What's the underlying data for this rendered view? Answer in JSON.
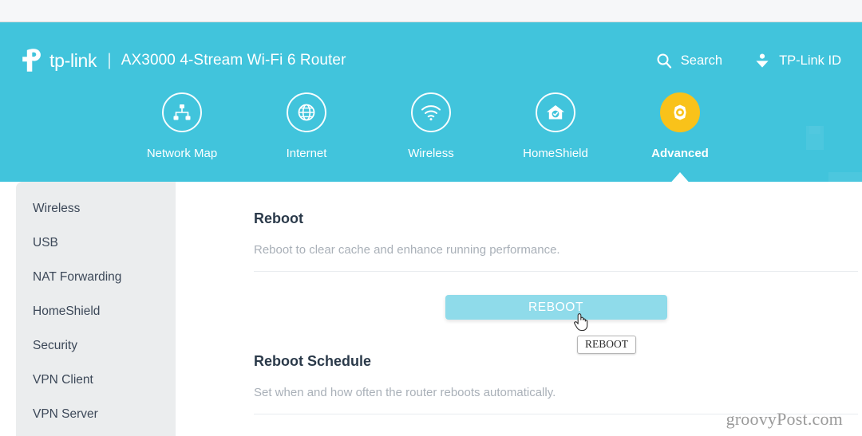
{
  "brand": {
    "logo_icon": "tp-link-logo-icon",
    "wordmark": "tp-link",
    "separator": "|",
    "model": "AX3000 4-Stream Wi-Fi 6 Router"
  },
  "header": {
    "actions": [
      {
        "label": "Search",
        "icon": "search-icon"
      },
      {
        "label": "TP-Link ID",
        "icon": "user-account-icon"
      }
    ],
    "background_color": "#41c4dc"
  },
  "topnav": {
    "items": [
      {
        "label": "Network Map",
        "icon": "network-topology-icon",
        "active": false
      },
      {
        "label": "Internet",
        "icon": "globe-icon",
        "active": false
      },
      {
        "label": "Wireless",
        "icon": "wifi-icon",
        "active": false
      },
      {
        "label": "HomeShield",
        "icon": "home-shield-icon",
        "active": false
      },
      {
        "label": "Advanced",
        "icon": "gear-icon",
        "active": true
      }
    ],
    "active_color": "#f9c21a"
  },
  "sidebar": {
    "items": [
      {
        "label": "Wireless"
      },
      {
        "label": "USB"
      },
      {
        "label": "NAT Forwarding"
      },
      {
        "label": "HomeShield"
      },
      {
        "label": "Security"
      },
      {
        "label": "VPN Client"
      },
      {
        "label": "VPN Server"
      }
    ],
    "background_color": "#ebedee"
  },
  "main": {
    "reboot_section": {
      "title": "Reboot",
      "description": "Reboot to clear cache and enhance running performance.",
      "button_label": "REBOOT",
      "button_color": "#8fdbea"
    },
    "schedule_section": {
      "title": "Reboot Schedule",
      "description": "Set when and how often the router reboots automatically."
    }
  },
  "tooltip": {
    "text": "REBOOT"
  },
  "cursor": {
    "type": "pointing-hand"
  },
  "watermark": {
    "text": "groovyPost.com"
  }
}
